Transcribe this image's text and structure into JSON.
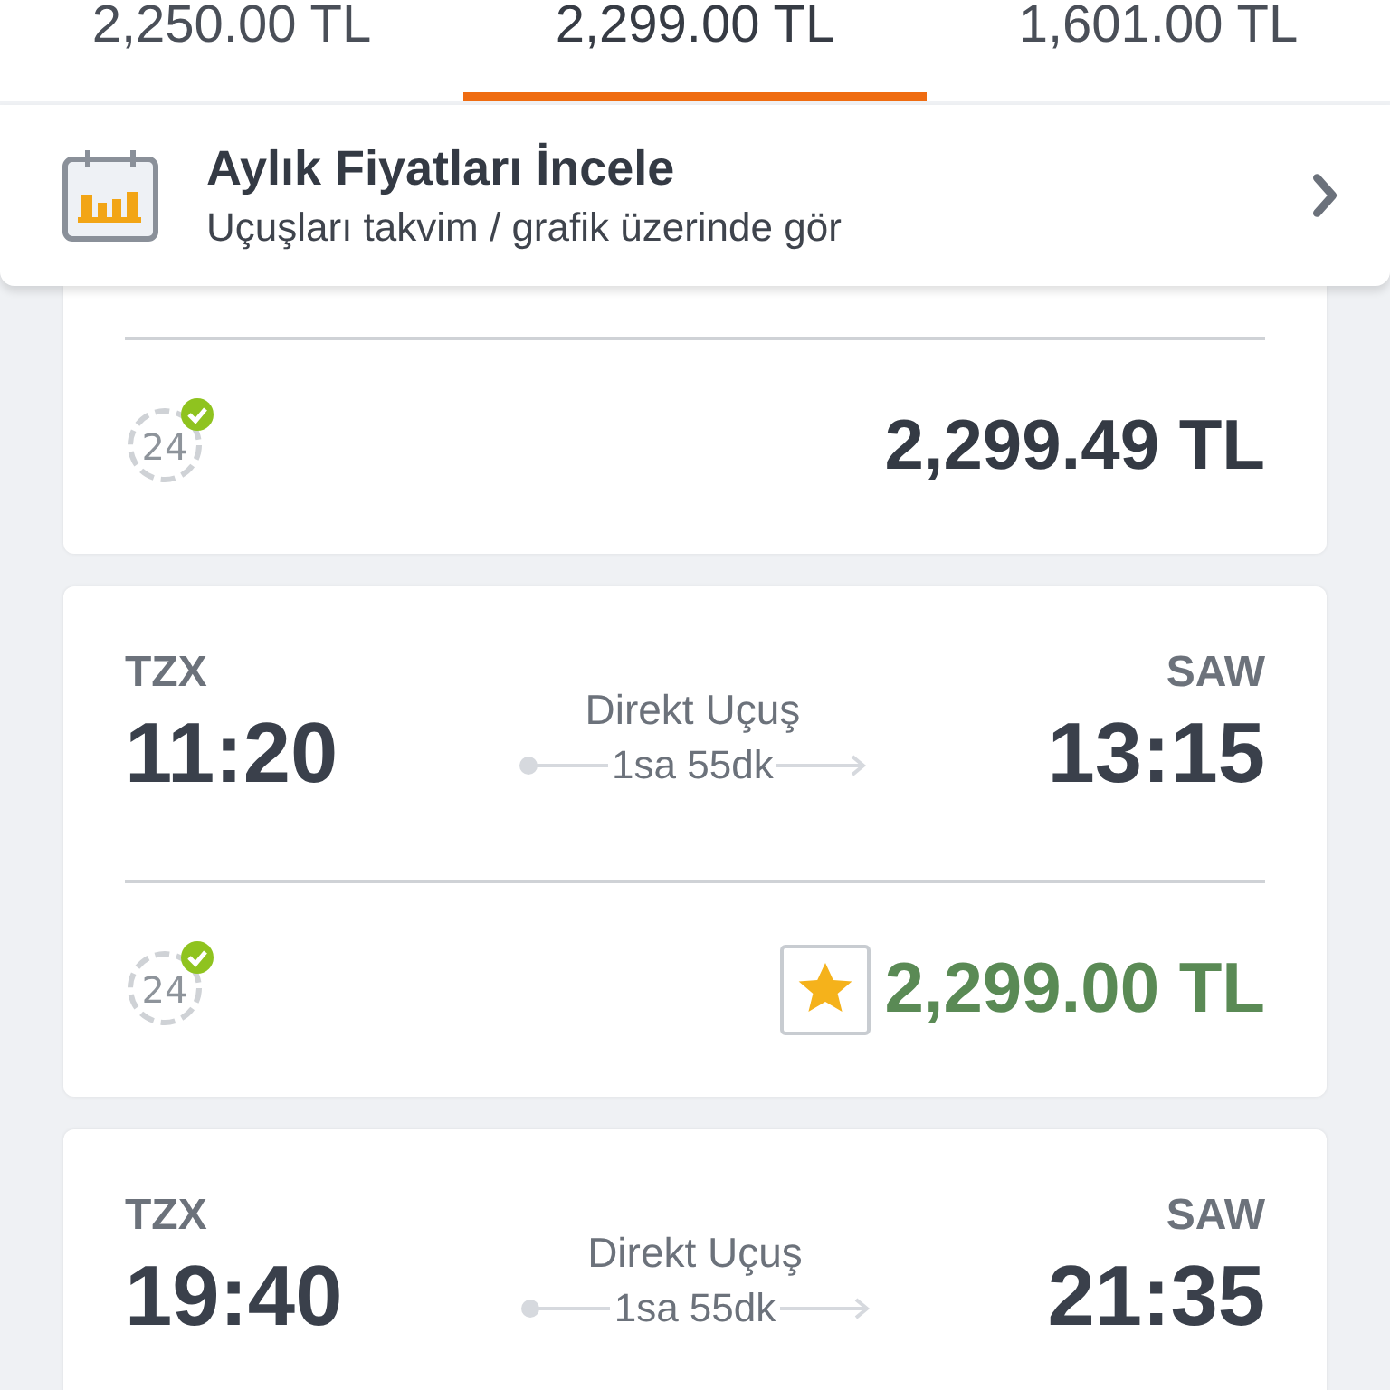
{
  "price_tabs": [
    {
      "label": "2,250.00 TL",
      "selected": false
    },
    {
      "label": "2,299.00 TL",
      "selected": true
    },
    {
      "label": "1,601.00 TL",
      "selected": false
    }
  ],
  "monthly_banner": {
    "title": "Aylık Fiyatları İncele",
    "subtitle": "Uçuşları takvim / grafik üzerinde gör"
  },
  "flights": [
    {
      "price": "2,299.49 TL",
      "featured": false,
      "service_label": "24",
      "guaranteed": true
    },
    {
      "origin": "TZX",
      "departure": "11:20",
      "type": "Direkt Uçuş",
      "duration": "1sa 55dk",
      "destination": "SAW",
      "arrival": "13:15",
      "price": "2,299.00 TL",
      "featured": true,
      "service_label": "24",
      "guaranteed": true
    },
    {
      "origin": "TZX",
      "departure": "19:40",
      "type": "Direkt Uçuş",
      "duration": "1sa 55dk",
      "destination": "SAW",
      "arrival": "21:35"
    }
  ]
}
